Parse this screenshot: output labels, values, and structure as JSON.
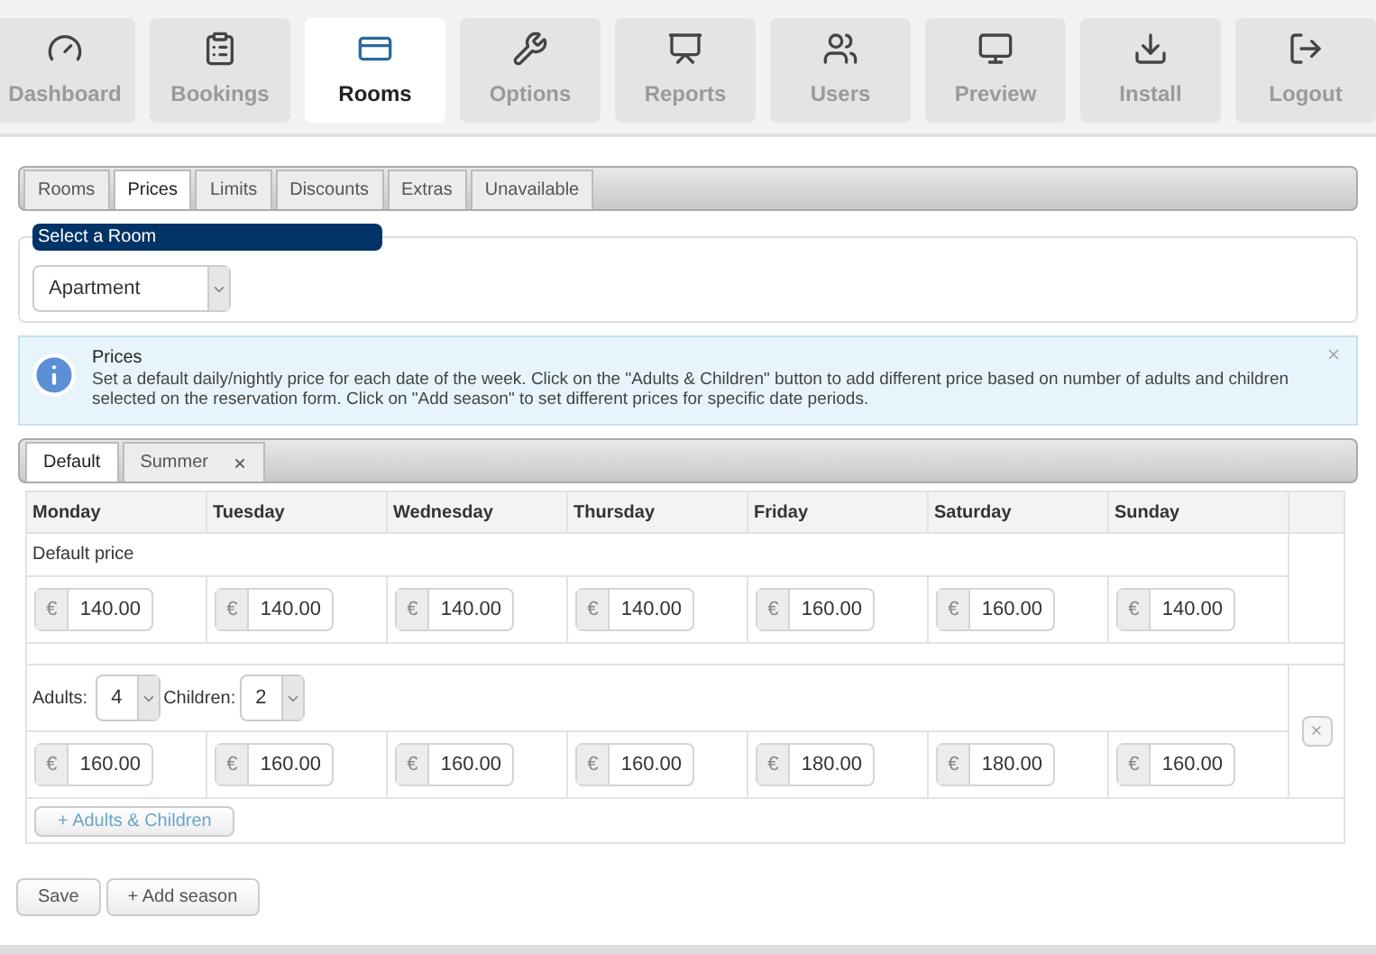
{
  "nav": [
    {
      "label": "Dashboard",
      "selected": false
    },
    {
      "label": "Bookings",
      "selected": false
    },
    {
      "label": "Rooms",
      "selected": true
    },
    {
      "label": "Options",
      "selected": false
    },
    {
      "label": "Reports",
      "selected": false
    },
    {
      "label": "Users",
      "selected": false
    },
    {
      "label": "Preview",
      "selected": false
    },
    {
      "label": "Install",
      "selected": false
    },
    {
      "label": "Logout",
      "selected": false
    }
  ],
  "subtabs": [
    {
      "label": "Rooms",
      "selected": false
    },
    {
      "label": "Prices",
      "selected": true
    },
    {
      "label": "Limits",
      "selected": false
    },
    {
      "label": "Discounts",
      "selected": false
    },
    {
      "label": "Extras",
      "selected": false
    },
    {
      "label": "Unavailable",
      "selected": false
    }
  ],
  "room_select": {
    "legend": "Select a Room",
    "value": "Apartment"
  },
  "info": {
    "title": "Prices",
    "text": "Set a default daily/nightly price for each date of the week. Click on the \"Adults & Children\" button to add different price based on number of adults and children selected on the reservation form. Click on \"Add season\" to set different prices for specific date periods."
  },
  "season_tabs": [
    {
      "label": "Default",
      "selected": true,
      "closable": false
    },
    {
      "label": "Summer",
      "selected": false,
      "closable": true
    }
  ],
  "table": {
    "columns": [
      "Monday",
      "Tuesday",
      "Wednesday",
      "Thursday",
      "Friday",
      "Saturday",
      "Sunday"
    ],
    "groups": [
      {
        "kind": "default",
        "label": "Default price",
        "prices": [
          {
            "currency": "€",
            "value": "140.00"
          },
          {
            "currency": "€",
            "value": "140.00"
          },
          {
            "currency": "€",
            "value": "140.00"
          },
          {
            "currency": "€",
            "value": "140.00"
          },
          {
            "currency": "€",
            "value": "160.00"
          },
          {
            "currency": "€",
            "value": "160.00"
          },
          {
            "currency": "€",
            "value": "140.00"
          }
        ]
      },
      {
        "kind": "occupancy",
        "adults_label": "Adults:",
        "adults": "4",
        "children_label": "Children:",
        "children": "2",
        "prices": [
          {
            "currency": "€",
            "value": "160.00"
          },
          {
            "currency": "€",
            "value": "160.00"
          },
          {
            "currency": "€",
            "value": "160.00"
          },
          {
            "currency": "€",
            "value": "160.00"
          },
          {
            "currency": "€",
            "value": "180.00"
          },
          {
            "currency": "€",
            "value": "180.00"
          },
          {
            "currency": "€",
            "value": "160.00"
          }
        ]
      }
    ],
    "add_button": "+ Adults & Children"
  },
  "buttons": [
    "Save",
    "+ Add season"
  ]
}
